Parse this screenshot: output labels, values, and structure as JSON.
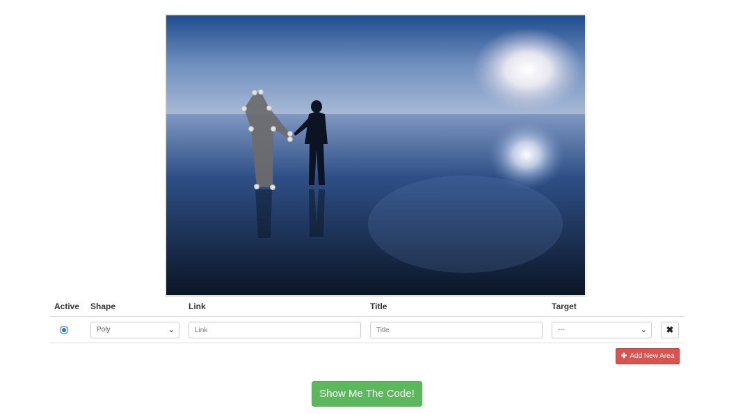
{
  "image": {
    "subject": "two people holding hands on reflective salt flat at dusk",
    "polygon_handles": 10
  },
  "table": {
    "headers": {
      "active": "Active",
      "shape": "Shape",
      "link": "Link",
      "title": "Title",
      "target": "Target"
    },
    "rows": [
      {
        "active": true,
        "shape": "Poly",
        "link_placeholder": "Link",
        "title_placeholder": "Title",
        "target": "---"
      }
    ],
    "delete_icon": "✖"
  },
  "buttons": {
    "add_new_area": "Add New Area",
    "add_icon": "✚",
    "show_code": "Show Me The Code!"
  },
  "colors": {
    "danger": "#d9534f",
    "success": "#5cb85c",
    "radio": "#1a73e8"
  }
}
